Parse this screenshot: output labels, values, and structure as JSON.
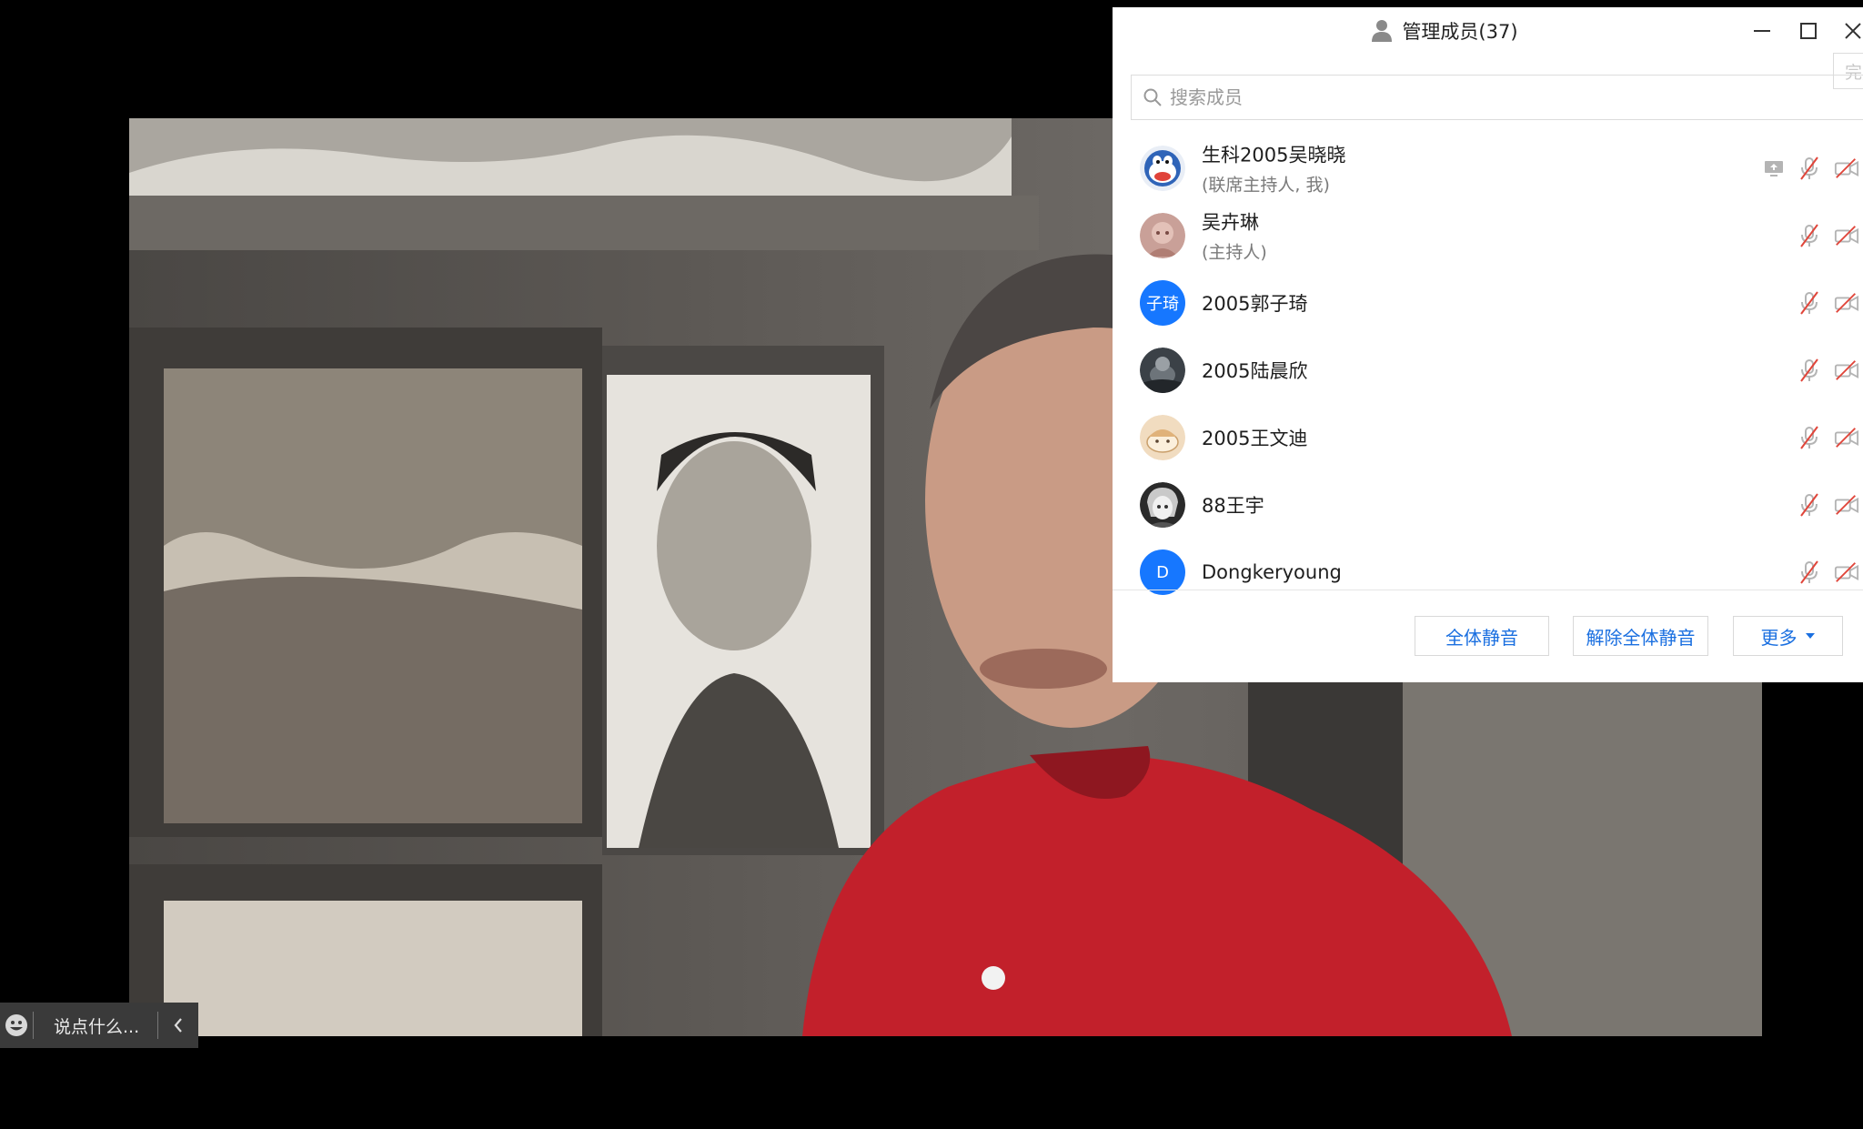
{
  "colors": {
    "accent_blue": "#1677ff",
    "link_blue": "#1a6fe0",
    "muted_red": "#e0453a",
    "icon_gray": "#b4b4b4"
  },
  "chat": {
    "placeholder": "说点什么...",
    "emoji_icon": "emoji-icon",
    "collapse_icon": "chevron-left-icon"
  },
  "panel": {
    "title": "管理成员(37)",
    "title_icon": "person-icon",
    "done_label": "完成",
    "search_placeholder": "搜索成员",
    "members": [
      {
        "name": "生科2005吴晓晓",
        "role": "(联席主持人, 我)",
        "avatar": "cartoon-cat-avatar",
        "share_icon": true
      },
      {
        "name": "吴卉琳",
        "role": "(主持人)",
        "avatar": "photo-avatar"
      },
      {
        "name": "2005郭子琦",
        "role": "",
        "avatar_text": "子琦"
      },
      {
        "name": "2005陆晨欣",
        "role": "",
        "avatar": "photo-avatar"
      },
      {
        "name": "2005王文迪",
        "role": "",
        "avatar": "cartoon-avatar"
      },
      {
        "name": "88王宇",
        "role": "",
        "avatar": "anime-avatar"
      },
      {
        "name": "Dongkeryoung",
        "role": "",
        "avatar_text": "D"
      }
    ],
    "buttons": {
      "mute_all": "全体静音",
      "unmute_all": "解除全体静音",
      "more": "更多"
    }
  }
}
